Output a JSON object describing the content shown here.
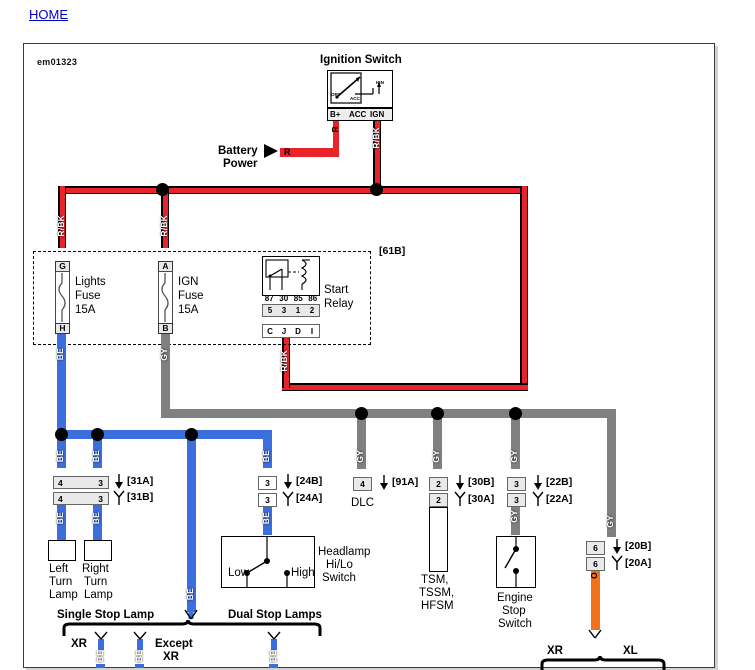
{
  "page": {
    "home_link": "HOME",
    "diagram_id": "em01323"
  },
  "components": {
    "ignition_switch": {
      "title": "Ignition Switch",
      "positions": [
        "OFF",
        "ACC",
        "IGN"
      ],
      "pins": [
        "B+",
        "ACC",
        "IGN"
      ]
    },
    "battery_power": {
      "label_line1": "Battery",
      "label_line2": "Power",
      "wire": "R"
    },
    "lights_fuse": {
      "top_terminal": "G",
      "bottom_terminal": "H",
      "name_line1": "Lights",
      "name_line2": "Fuse",
      "rating": "15A"
    },
    "ign_fuse": {
      "top_terminal": "A",
      "bottom_terminal": "B",
      "name_line1": "IGN",
      "name_line2": "Fuse",
      "rating": "15A"
    },
    "start_relay": {
      "name_line1": "Start",
      "name_line2": "Relay",
      "row1": [
        "87",
        "30",
        "85",
        "86"
      ],
      "row2": [
        "5",
        "3",
        "1",
        "2"
      ],
      "row3": [
        "C",
        "J",
        "D",
        "I"
      ]
    },
    "fuse_block_ref": "[61B]",
    "left_turn_lamp": {
      "line1": "Left",
      "line2": "Turn",
      "line3": "Lamp"
    },
    "right_turn_lamp": {
      "line1": "Right",
      "line2": "Turn",
      "line3": "Lamp"
    },
    "headlamp_switch": {
      "line1": "Headlamp",
      "line2": "Hi/Lo",
      "line3": "Switch",
      "pos_low": "Low",
      "pos_high": "High"
    },
    "dlc": {
      "label": "DLC"
    },
    "tsm_module": {
      "line1": "TSM,",
      "line2": "TSSM,",
      "line3": "HFSM"
    },
    "engine_stop_switch": {
      "line1": "Engine",
      "line2": "Stop",
      "line3": "Switch"
    }
  },
  "connectors": [
    {
      "ref_b": "[31A]",
      "ref_a": "[31B]",
      "pin_left": "4",
      "pin_right": "3"
    },
    {
      "ref_b": "[24B]",
      "ref_a": "[24A]",
      "pin": "3"
    },
    {
      "ref_b": "[91A]",
      "pin": "4"
    },
    {
      "ref_b": "[30B]",
      "ref_a": "[30A]",
      "pin": "2"
    },
    {
      "ref_b": "[22B]",
      "ref_a": "[22A]",
      "pin": "3"
    },
    {
      "ref_b": "[20B]",
      "ref_a": "[20A]",
      "pin": "6"
    }
  ],
  "wire_labels": {
    "rbk": "R/BK",
    "r": "R",
    "be": "BE",
    "gy": "GY",
    "o": "O"
  },
  "brackets": {
    "single_stop_lamp": "Single Stop Lamp",
    "dual_stop_lamps": "Dual Stop Lamps",
    "xr": "XR",
    "xl": "XL",
    "except_xr_line1": "Except",
    "except_xr_line2": "XR"
  },
  "colors": {
    "red": "#e8232a",
    "blue": "#3b6fdd",
    "gray": "#808080",
    "orange": "#f2711c",
    "black": "#000000",
    "link": "#0000cc"
  }
}
